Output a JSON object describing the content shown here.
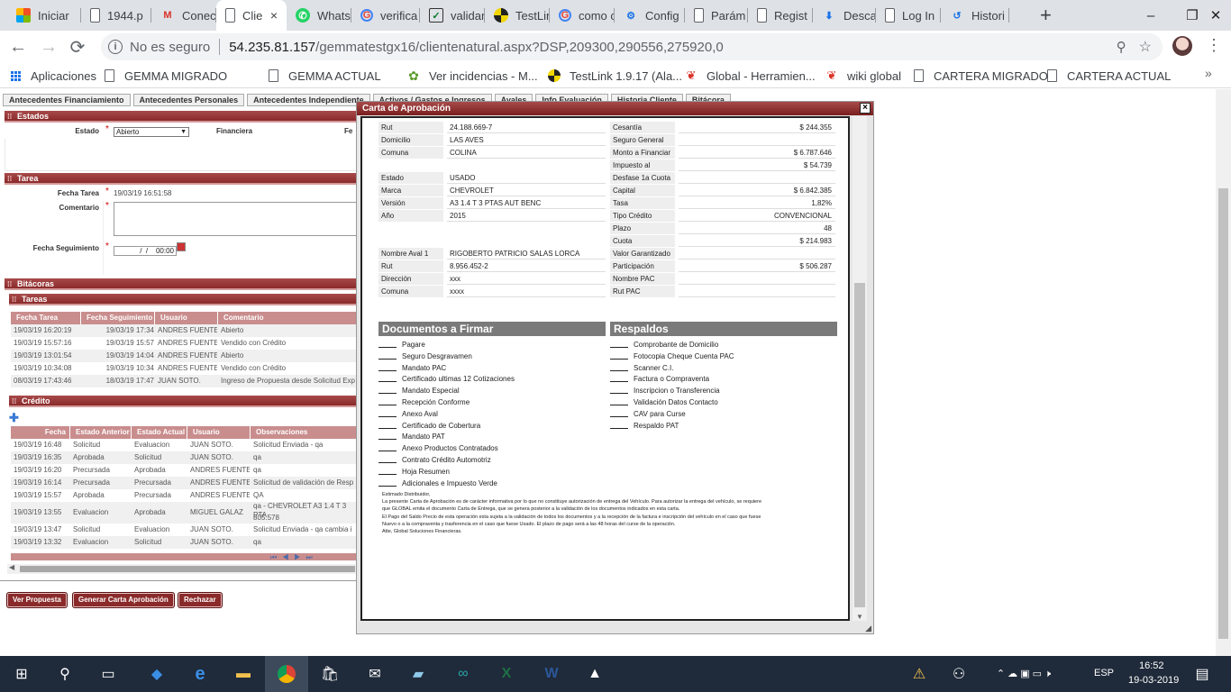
{
  "browser": {
    "tabs": [
      {
        "label": "Iniciar",
        "icon": "windows-logo-icon"
      },
      {
        "label": "1944.p",
        "icon": "document-icon"
      },
      {
        "label": "Conect",
        "icon": "gmail-icon"
      },
      {
        "label": "Clie",
        "icon": "document-icon",
        "active": true
      },
      {
        "label": "Whats",
        "icon": "whatsapp-icon"
      },
      {
        "label": "verifica",
        "icon": "google-icon"
      },
      {
        "label": "validar",
        "icon": "checkbox-icon"
      },
      {
        "label": "TestLin",
        "icon": "testlink-icon"
      },
      {
        "label": "como c",
        "icon": "google-icon"
      },
      {
        "label": "Config",
        "icon": "gear-icon"
      },
      {
        "label": "Parám",
        "icon": "document-icon"
      },
      {
        "label": "Regist",
        "icon": "document-icon"
      },
      {
        "label": "Descar",
        "icon": "download-icon"
      },
      {
        "label": "Log In",
        "icon": "document-icon"
      },
      {
        "label": "Histori",
        "icon": "history-icon"
      }
    ],
    "new_tab": "+",
    "address": {
      "security": "No es seguro",
      "host": "54.235.81.157",
      "path": "/gemmatestgx16/clientenatural.aspx?DSP,209300,290556,275920,0"
    },
    "bookmarks": [
      {
        "label": "Aplicaciones",
        "icon": "apps-icon"
      },
      {
        "label": "GEMMA MIGRADO",
        "icon": "document-icon"
      },
      {
        "label": "GEMMA ACTUAL",
        "icon": "document-icon"
      },
      {
        "label": "Ver incidencias - M...",
        "icon": "bug-icon"
      },
      {
        "label": "TestLink 1.9.17 (Ala...",
        "icon": "testlink-icon"
      },
      {
        "label": "Global - Herramien...",
        "icon": "global-icon"
      },
      {
        "label": "wiki global",
        "icon": "global-icon"
      },
      {
        "label": "CARTERA MIGRADO",
        "icon": "document-icon"
      },
      {
        "label": "CARTERA ACTUAL",
        "icon": "document-icon"
      }
    ]
  },
  "page": {
    "tabs": [
      "Antecedentes Financiamiento",
      "Antecedentes Personales",
      "Antecedentes Independiente",
      "Activos / Gastos e Ingresos",
      "Avales",
      "Info Evaluación",
      "Historia Cliente",
      "Bitácora"
    ],
    "estados": {
      "title": "Estados",
      "estado_label": "Estado",
      "estado_value": "Abierto",
      "financiera_label": "Financiera",
      "fe_label": "Fe"
    },
    "tarea": {
      "title": "Tarea",
      "fecha_label": "Fecha Tarea",
      "fecha_value": "19/03/19 16:51:58",
      "comentario_label": "Comentario",
      "seguimiento_label": "Fecha Seguimiento",
      "seguimiento_value": "  /  /    00:00"
    },
    "bitacoras_title": "Bitácoras",
    "tareas": {
      "title": "Tareas",
      "columns": [
        "Fecha Tarea",
        "Fecha Seguimiento",
        "Usuario",
        "Comentario"
      ],
      "rows": [
        [
          "19/03/19 16:20:19",
          "19/03/19 17:34",
          "ANDRES FUENTES",
          "Abierto"
        ],
        [
          "19/03/19 15:57:16",
          "19/03/19 15:57",
          "ANDRES FUENTES",
          "Vendido con Crédito"
        ],
        [
          "19/03/19 13:01:54",
          "19/03/19 14:04",
          "ANDRES FUENTES",
          "Abierto"
        ],
        [
          "19/03/19 10:34:08",
          "19/03/19 10:34",
          "ANDRES FUENTES",
          "Vendido con Crédito"
        ],
        [
          "08/03/19 17:43:46",
          "18/03/19 17:47",
          "JUAN SOTO.",
          "Ingreso de Propuesta desde Solicitud Exp"
        ]
      ]
    },
    "credito": {
      "title": "Crédito",
      "columns": [
        "Fecha",
        "Estado Anterior",
        "Estado Actual",
        "Usuario",
        "Observaciones"
      ],
      "rows": [
        [
          "19/03/19 16:48",
          "Solicitud",
          "Evaluacion",
          "JUAN SOTO.",
          "Solicitud Enviada - qa"
        ],
        [
          "19/03/19 16:35",
          "Aprobada",
          "Solicitud",
          "JUAN SOTO.",
          "qa"
        ],
        [
          "19/03/19 16:20",
          "Precursada",
          "Aprobada",
          "ANDRES FUENTES",
          "qa"
        ],
        [
          "19/03/19 16:14",
          "Precursada",
          "Precursada",
          "ANDRES FUENTES",
          "Solicitud de validación de Resp"
        ],
        [
          "19/03/19 15:57",
          "Aprobada",
          "Precursada",
          "ANDRES FUENTES",
          "QA"
        ],
        [
          "19/03/19 13:55",
          "Evaluacion",
          "Aprobada",
          "MIGUEL GALAZ",
          "qa - CHEVROLET A3 1.4 T 3 PTA"
        ],
        [
          "19/03/19 13:47",
          "Solicitud",
          "Evaluacion",
          "JUAN SOTO.",
          "Solicitud Enviada - qa cambia i"
        ],
        [
          "19/03/19 13:32",
          "Evaluacion",
          "Solicitud",
          "JUAN SOTO.",
          "qa"
        ]
      ],
      "row6_extra": "805.578"
    },
    "buttons": {
      "ver": "Ver Propuesta",
      "generar": "Generar Carta Aprobación",
      "rechazar": "Rechazar"
    }
  },
  "modal": {
    "title": "Carta de Aprobación",
    "close": "×",
    "left_block1": [
      [
        "Rut",
        "24.188.669-7"
      ],
      [
        "Domicilio",
        "LAS AVES"
      ],
      [
        "Comuna",
        "COLINA"
      ]
    ],
    "left_block2": [
      [
        "Estado",
        "USADO"
      ],
      [
        "Marca",
        "CHEVROLET"
      ],
      [
        "Versión",
        "A3 1.4 T 3 PTAS AUT BENC"
      ],
      [
        "Año",
        "2015"
      ]
    ],
    "left_block3": [
      [
        "Nombre Aval 1",
        "RIGOBERTO PATRICIO SALAS LORCA"
      ],
      [
        "Rut",
        "8.956.452-2"
      ],
      [
        "Dirección",
        "xxx"
      ],
      [
        "Comuna",
        "xxxx"
      ]
    ],
    "right_rows": [
      [
        "Cesantía",
        "$ 244.355"
      ],
      [
        "Seguro General",
        ""
      ],
      [
        "Monto a Financiar",
        "$ 6.787.646"
      ],
      [
        "Impuesto al Pagare",
        "$ 54.739"
      ],
      [
        "Desfase 1a Cuota",
        ""
      ],
      [
        "Capital",
        "$ 6.842.385"
      ],
      [
        "Tasa",
        "1,82%"
      ],
      [
        "Tipo Crédito",
        "CONVENCIONAL"
      ],
      [
        "Plazo",
        "48"
      ],
      [
        "Cuota",
        "$ 214.983"
      ],
      [
        "Valor Garantizado",
        ""
      ],
      [
        "Participación",
        "$ 506.287"
      ],
      [
        "Nombre PAC",
        ""
      ],
      [
        "Rut PAC",
        ""
      ]
    ],
    "documentos_title": "Documentos a Firmar",
    "documentos": [
      "Pagare",
      "Seguro Desgravamen",
      "Mandato PAC",
      "Certificado ultimas 12 Cotizaciones",
      "Mandato Especial",
      "Recepción Conforme",
      "Anexo Aval",
      "Certificado de Cobertura",
      "Mandato PAT",
      "Anexo Productos Contratados",
      "Contrato Crédito Automotriz",
      "Hoja Resumen",
      "Adicionales e Impuesto Verde"
    ],
    "respaldos_title": "Respaldos",
    "respaldos": [
      "Comprobante de Domicilio",
      "Fotocopia Cheque Cuenta PAC",
      "Scanner C.I.",
      "Factura o Compraventa",
      "Inscripcion o Transferencia",
      "Validación Datos Contacto",
      "CAV para Curse",
      "Respaldo PAT"
    ],
    "note": [
      "Estimado Distribuidor,",
      "La presente Carta de Aprobación es de carácter informativa por lo que no constituye autorización de entrega del Vehículo. Para autorizar la entrega del vehículo, se requiere",
      "que GLOBAL emita el documento Carta de Entrega, que se genera posterior a la validación de los documentos  indicados en esta carta.",
      "El Pago del Saldo Precio de esta operación esta sujeta a la validación de todos los documentos y a la recepción de la factura e inscripción del vehículo en el caso que fuese",
      "Nuevo o a la  compraventa y trasferencia en el caso que fuese Usado. El plazo de pago será a las 48 horas del curse de la operación.",
      "Atte, Global Soluciones Financieras."
    ]
  },
  "taskbar": {
    "lang": "ESP",
    "time": "16:52",
    "date": "19-03-2019"
  }
}
